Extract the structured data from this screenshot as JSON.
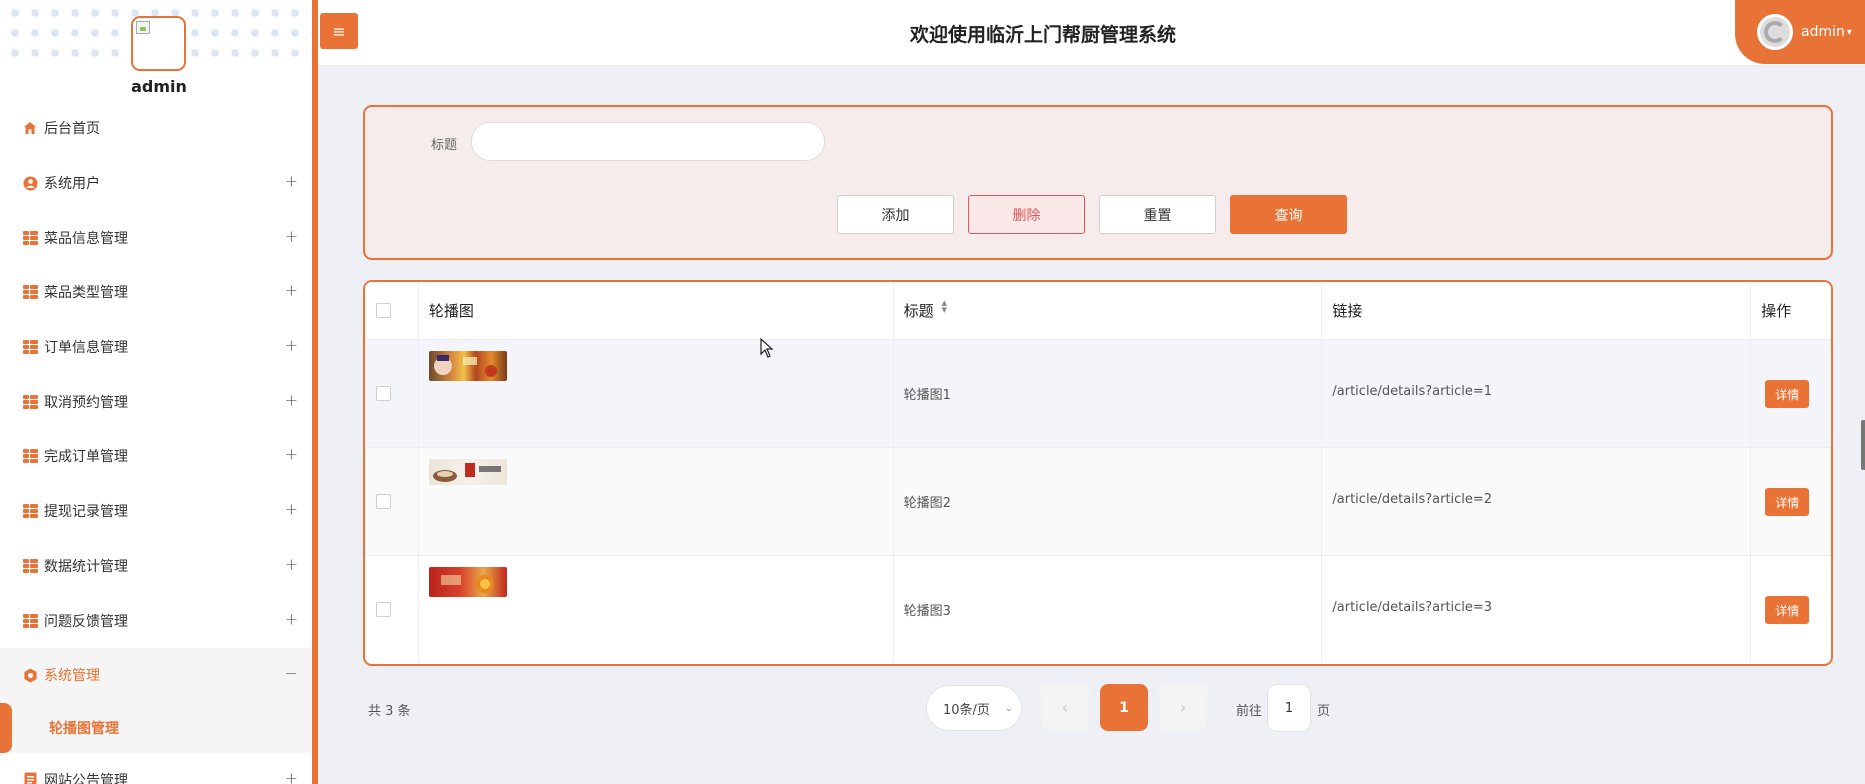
{
  "sidebar": {
    "admin_name": "admin",
    "items": [
      {
        "label": "后台首页",
        "icon": "home-icon",
        "expandable": false
      },
      {
        "label": "系统用户",
        "icon": "user-icon",
        "expandable": true
      },
      {
        "label": "菜品信息管理",
        "icon": "grid-icon",
        "expandable": true
      },
      {
        "label": "菜品类型管理",
        "icon": "grid-icon",
        "expandable": true
      },
      {
        "label": "订单信息管理",
        "icon": "grid-icon",
        "expandable": true
      },
      {
        "label": "取消预约管理",
        "icon": "grid-icon",
        "expandable": true
      },
      {
        "label": "完成订单管理",
        "icon": "grid-icon",
        "expandable": true
      },
      {
        "label": "提现记录管理",
        "icon": "grid-icon",
        "expandable": true
      },
      {
        "label": "数据统计管理",
        "icon": "grid-icon",
        "expandable": true
      },
      {
        "label": "问题反馈管理",
        "icon": "grid-icon",
        "expandable": true
      },
      {
        "label": "系统管理",
        "icon": "gear-icon",
        "expandable": true,
        "expanded": true
      },
      {
        "label": "网站公告管理",
        "icon": "doc-icon",
        "expandable": true
      }
    ],
    "plus": "+",
    "minus": "−",
    "submenu": {
      "label": "轮播图管理"
    }
  },
  "header": {
    "title": "欢迎使用临沂上门帮厨管理系统",
    "user_name": "admin",
    "menu_icon": "≡"
  },
  "search": {
    "label": "标题",
    "placeholder": "",
    "buttons": {
      "add": "添加",
      "delete": "删除",
      "reset": "重置",
      "query": "查询"
    }
  },
  "table": {
    "columns": {
      "image": "轮播图",
      "title": "标题",
      "link": "链接",
      "action": "操作"
    },
    "rows": [
      {
        "title": "轮播图1",
        "link": "/article/details?article=1",
        "action": "详情"
      },
      {
        "title": "轮播图2",
        "link": "/article/details?article=2",
        "action": "详情"
      },
      {
        "title": "轮播图3",
        "link": "/article/details?article=3",
        "action": "详情"
      }
    ]
  },
  "pagination": {
    "total": "共 3 条",
    "page_size": "10条/页",
    "current": "1",
    "goto_prefix": "前往",
    "goto_value": "1",
    "goto_suffix": "页",
    "prev": "‹",
    "next": "›"
  },
  "colors": {
    "accent": "#e97336",
    "danger": "#e45656",
    "panel_bg": "#f7ecec"
  }
}
